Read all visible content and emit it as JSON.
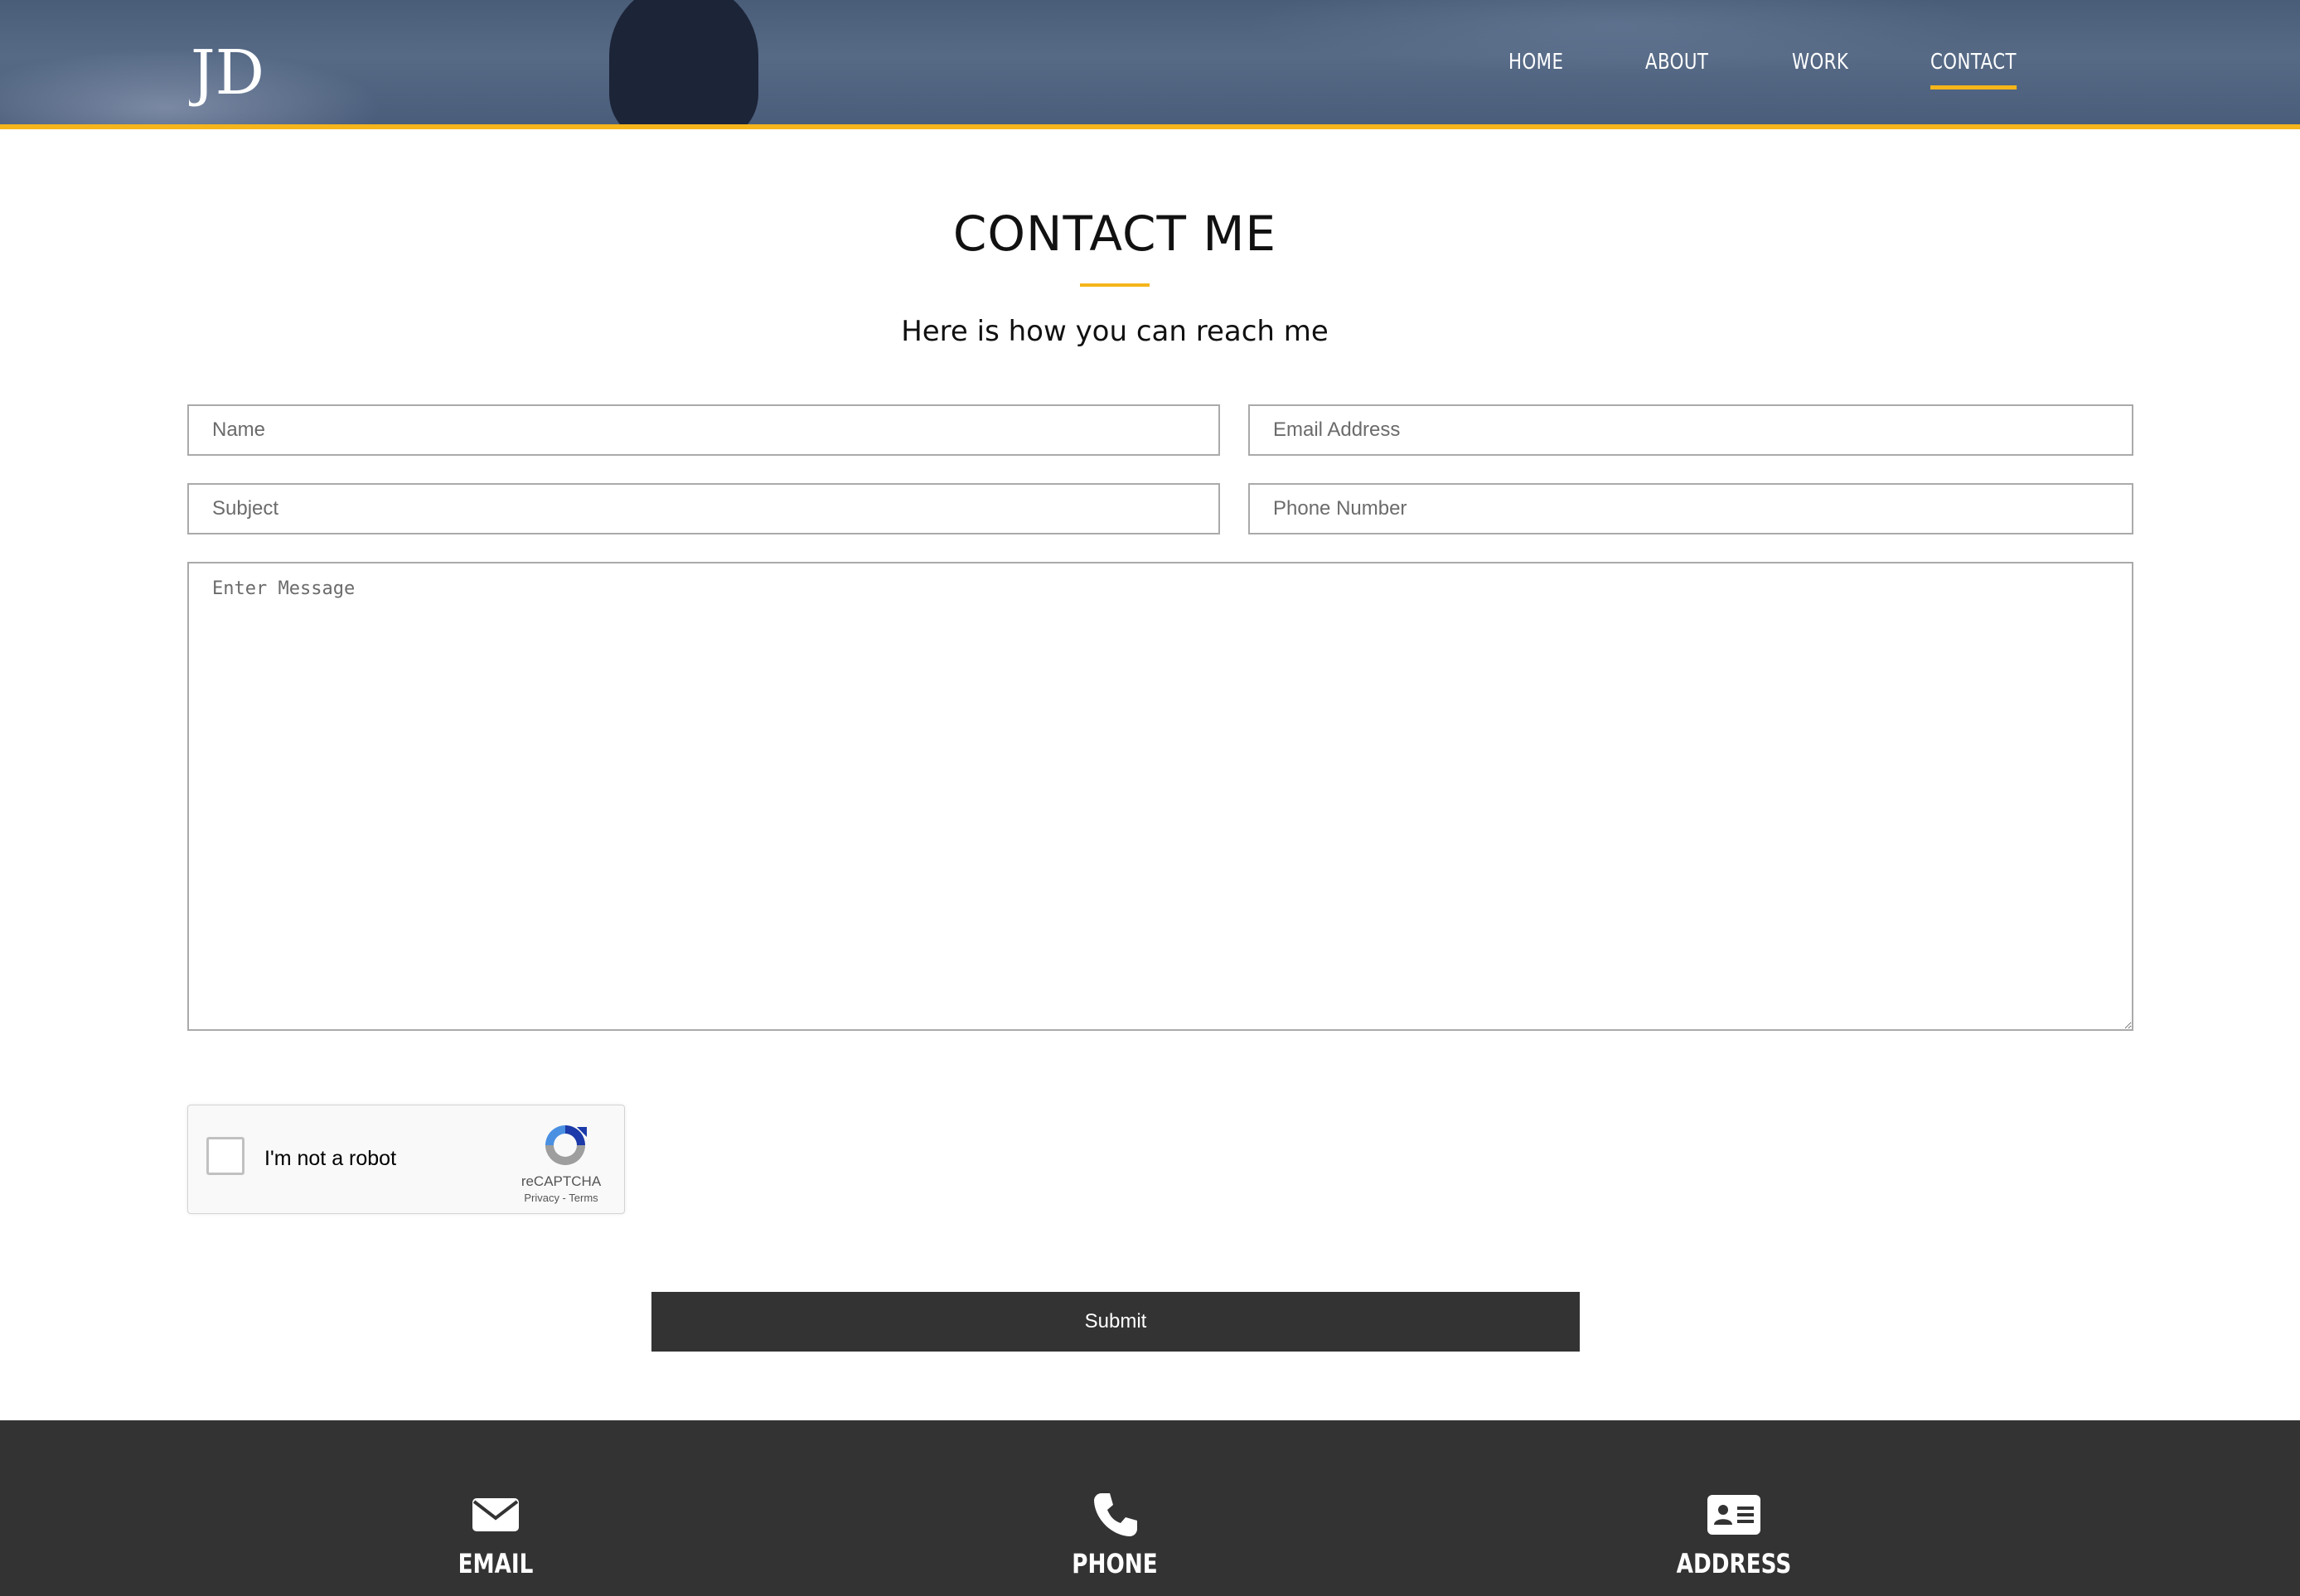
{
  "header": {
    "logo_text": "JD",
    "nav": [
      {
        "label": "HOME",
        "active": false
      },
      {
        "label": "ABOUT",
        "active": false
      },
      {
        "label": "WORK",
        "active": false
      },
      {
        "label": "CONTACT",
        "active": true
      }
    ],
    "accent_color": "#f5b51b"
  },
  "contact": {
    "title": "CONTACT ME",
    "subtitle": "Here is how you can reach me",
    "fields": {
      "name_placeholder": "Name",
      "email_placeholder": "Email Address",
      "subject_placeholder": "Subject",
      "phone_placeholder": "Phone Number",
      "message_placeholder": "Enter Message",
      "name_value": "",
      "email_value": "",
      "subject_value": "",
      "phone_value": "",
      "message_value": ""
    },
    "recaptcha": {
      "label": "I'm not a robot",
      "brand": "reCAPTCHA",
      "links": "Privacy - Terms",
      "checked": false
    },
    "submit_label": "Submit"
  },
  "footer": {
    "items": [
      {
        "label": "EMAIL",
        "icon": "envelope-icon"
      },
      {
        "label": "PHONE",
        "icon": "phone-icon"
      },
      {
        "label": "ADDRESS",
        "icon": "address-card-icon"
      }
    ],
    "background": "#333333"
  }
}
